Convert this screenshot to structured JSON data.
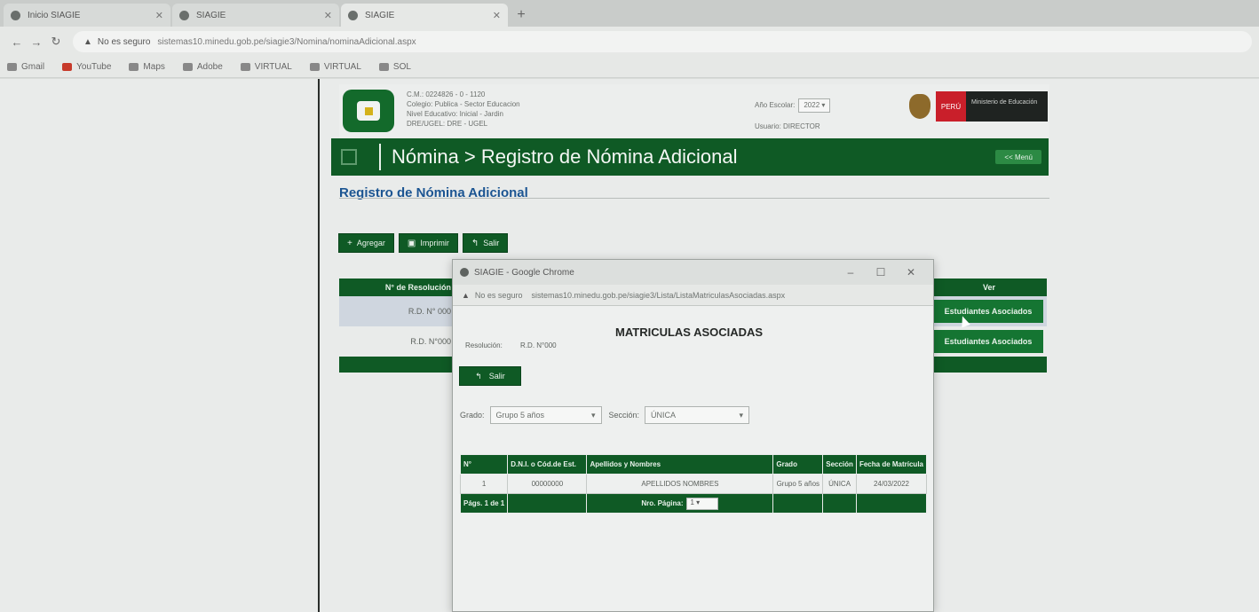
{
  "browser": {
    "tabs": [
      {
        "label": "Inicio SIAGIE"
      },
      {
        "label": "SIAGIE"
      },
      {
        "label": "SIAGIE"
      }
    ],
    "new_tab": "+",
    "url_warning": "No es seguro",
    "url": "sistemas10.minedu.gob.pe/siagie3/Nomina/nominaAdicional.aspx",
    "bookmarks": [
      {
        "label": "Gmail"
      },
      {
        "label": "YouTube"
      },
      {
        "label": "Maps"
      },
      {
        "label": "Adobe"
      },
      {
        "label": "VIRTUAL"
      },
      {
        "label": "VIRTUAL"
      },
      {
        "label": "SOL"
      }
    ]
  },
  "site": {
    "header_info": [
      "C.M.: 0224826 - 0 - 1120",
      "Colegio: Publica - Sector Educacion",
      "Nivel Educativo: Inicial - Jardin",
      "DRE/UGEL: DRE - UGEL"
    ],
    "year_label": "Año Escolar:",
    "year_value": "2022",
    "user_label": "Usuario: DIRECTOR",
    "gov_red": "PERÚ",
    "gov_name": "Ministerio de Educación",
    "bar_title": "Nómina > Registro de Nómina Adicional",
    "bar_button": "<< Menú",
    "section_title": "Registro de Nómina Adicional",
    "actions": [
      {
        "icon": "+",
        "label": "Agregar"
      },
      {
        "icon": "▣",
        "label": "Imprimir"
      },
      {
        "icon": "↰",
        "label": "Salir"
      }
    ],
    "table_header": {
      "resolution": "N° de Resolución",
      "see": "Ver"
    },
    "rows": [
      {
        "resolution": "R.D. N° 000",
        "button": "Estudiantes Asociados"
      },
      {
        "resolution": "R.D. N°000",
        "button": "Estudiantes Asociados"
      }
    ]
  },
  "popup": {
    "title": "SIAGIE - Google Chrome",
    "minimize": "–",
    "maximize": "☐",
    "close": "✕",
    "url_warning": "No es seguro",
    "url": "sistemas10.minedu.gob.pe/siagie3/Lista/ListaMatriculasAsociadas.aspx",
    "heading": "MATRICULAS ASOCIADAS",
    "resolution_label": "Resolución:",
    "resolution_value": "R.D. N°000",
    "exit_icon": "↰",
    "exit_label": "Salir",
    "grade_label": "Grado:",
    "grade_value": "Grupo 5 años",
    "section_label": "Sección:",
    "section_value": "ÚNICA",
    "columns": [
      "N°",
      "D.N.I. o Cód.de Est.",
      "Apellidos y Nombres",
      "Grado",
      "Sección",
      "Fecha de Matrícula"
    ],
    "students": [
      {
        "num": "1",
        "id": "00000000",
        "name": "APELLIDOS NOMBRES",
        "grade": "Grupo 5 años",
        "section": "ÚNICA",
        "date": "24/03/2022"
      }
    ],
    "footer_pages": "Págs. 1 de 1",
    "footer_page_label": "Nro. Página:",
    "footer_page_value": "1"
  },
  "colors": {
    "primary_green": "#0f5a25",
    "button_green": "#157532",
    "title_blue": "#1c5592",
    "gov_red": "#c91f2a"
  }
}
